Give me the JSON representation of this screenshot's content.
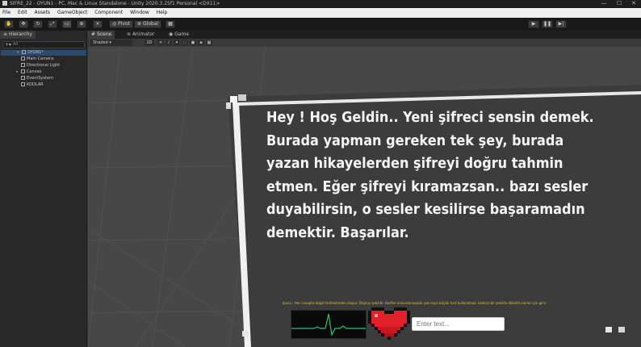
{
  "window": {
    "title": "SIFRE_22 - OYUN1 - PC, Mac & Linux Standalone - Unity 2020.3.25f1 Personal <DX11>"
  },
  "menu": [
    "File",
    "Edit",
    "Assets",
    "GameObject",
    "Component",
    "Window",
    "Help"
  ],
  "toolbar": {
    "pivot_label": "Pivot",
    "global_label": "Global"
  },
  "hierarchy": {
    "tab_label": "Hierarchy",
    "search_placeholder": "All",
    "scene_name": "OYUN1*",
    "items": [
      {
        "label": "Main Camera"
      },
      {
        "label": "Directional Light"
      },
      {
        "label": "Canvas"
      },
      {
        "label": "EventSystem"
      },
      {
        "label": "KODLAR"
      }
    ]
  },
  "scene": {
    "tabs": [
      {
        "label": "Scene"
      },
      {
        "label": "Animator"
      },
      {
        "label": "Game"
      }
    ],
    "shading_mode": "Shaded",
    "mode_2d": "2D"
  },
  "game_ui": {
    "story_lines": [
      "Hey ! Hoş Geldin.. Yeni şifreci sensin demek.",
      "Burada yapman gereken tek şey, burada",
      "yazan hikayelerden şifreyi doğru tahmin",
      "etmen. Eğer şifreyi kıramazsan.. bazı sesler",
      "duyabilirsin, o sesler kesilirse başaramadın",
      "demektir. Başarılar."
    ],
    "hint_text": "Ipucu : Her cevapta doğal kelimelerden oluşur. Doğrus şekilde. Harfler arasında boşluk yok veya büyük harf kullanılmaz, sadece bir şekilde dikkatli olurlar için girin",
    "input_placeholder": "Enter text..."
  },
  "colors": {
    "accent_selected": "#2c4a6e",
    "hint": "#d8c040",
    "heart": "#e0202a",
    "ecg_line": "#30c070"
  }
}
